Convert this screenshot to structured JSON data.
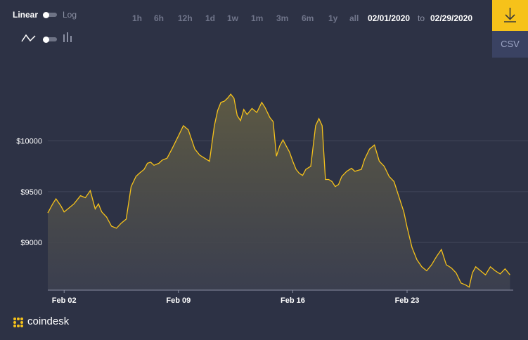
{
  "controls": {
    "scale_linear": "Linear",
    "scale_log": "Log",
    "ranges": [
      "1h",
      "6h",
      "12h",
      "1d",
      "1w",
      "1m",
      "3m",
      "6m",
      "1y",
      "all"
    ],
    "date_from": "02/01/2020",
    "date_to_sep": "to",
    "date_to": "02/29/2020",
    "csv_label": "CSV",
    "download_icon": "download-icon",
    "line_icon": "line-chart-icon",
    "bar_icon": "bar-chart-icon"
  },
  "brand": {
    "name": "coindesk",
    "logo_icon": "coindesk-logo-icon"
  },
  "colors": {
    "background": "#2d3245",
    "line": "#f6c21a",
    "accent": "#f6c21a",
    "csv_bg": "#3a4262"
  },
  "chart_data": {
    "type": "area",
    "y_ticks": [
      "$9000",
      "$9500",
      "$10000"
    ],
    "y_tick_values": [
      9000,
      9500,
      10000
    ],
    "x_ticks": [
      "Feb 02",
      "Feb 09",
      "Feb 16",
      "Feb 23"
    ],
    "ylim": [
      8530,
      10800
    ],
    "xlim": [
      0,
      28.5
    ],
    "grid": true,
    "series": [
      {
        "x": [
          0,
          0.3,
          0.5,
          0.8,
          1.0,
          1.3,
          1.6,
          2.0,
          2.3,
          2.6,
          2.9,
          3.1,
          3.3,
          3.6,
          3.9,
          4.2,
          4.5,
          4.8,
          5.1,
          5.4,
          5.6,
          5.9,
          6.1,
          6.3,
          6.5,
          6.8,
          7.0,
          7.3,
          7.6,
          8.0,
          8.3,
          8.6,
          9.0,
          9.3,
          9.6,
          9.9,
          10.2,
          10.4,
          10.6,
          10.8,
          11.0,
          11.2,
          11.4,
          11.6,
          11.8,
          12.0,
          12.2,
          12.5,
          12.8,
          13.1,
          13.3,
          13.6,
          13.8,
          14.0,
          14.2,
          14.4,
          14.6,
          14.8,
          15.0,
          15.2,
          15.4,
          15.6,
          15.8,
          16.1,
          16.4,
          16.6,
          16.8,
          17.0,
          17.2,
          17.4,
          17.6,
          17.8,
          18.0,
          18.3,
          18.6,
          18.8,
          19.0,
          19.2,
          19.4,
          19.7,
          20.0,
          20.3,
          20.6,
          20.9,
          21.2,
          21.5,
          21.8,
          22.0,
          22.3,
          22.6,
          22.9,
          23.2,
          23.5,
          23.8,
          24.1,
          24.4,
          24.7,
          25.0,
          25.3,
          25.6,
          25.8,
          26.0,
          26.2,
          26.5,
          26.8,
          27.1,
          27.4,
          27.7,
          28.0,
          28.3
        ],
        "values": [
          9290,
          9380,
          9430,
          9360,
          9300,
          9340,
          9380,
          9460,
          9440,
          9510,
          9330,
          9380,
          9300,
          9250,
          9160,
          9140,
          9190,
          9230,
          9550,
          9650,
          9680,
          9720,
          9780,
          9790,
          9760,
          9780,
          9810,
          9830,
          9920,
          10050,
          10150,
          10110,
          9920,
          9860,
          9830,
          9800,
          10150,
          10300,
          10380,
          10390,
          10420,
          10460,
          10420,
          10250,
          10200,
          10310,
          10260,
          10320,
          10280,
          10380,
          10330,
          10230,
          10190,
          9850,
          9950,
          10010,
          9950,
          9890,
          9800,
          9720,
          9680,
          9660,
          9720,
          9750,
          10150,
          10220,
          10150,
          9620,
          9620,
          9600,
          9550,
          9570,
          9650,
          9700,
          9730,
          9700,
          9710,
          9720,
          9820,
          9920,
          9960,
          9800,
          9750,
          9650,
          9600,
          9450,
          9300,
          9150,
          8950,
          8830,
          8760,
          8720,
          8780,
          8860,
          8930,
          8780,
          8750,
          8700,
          8600,
          8580,
          8560,
          8700,
          8760,
          8720,
          8680,
          8760,
          8720,
          8690,
          8740,
          8680
        ]
      }
    ]
  }
}
